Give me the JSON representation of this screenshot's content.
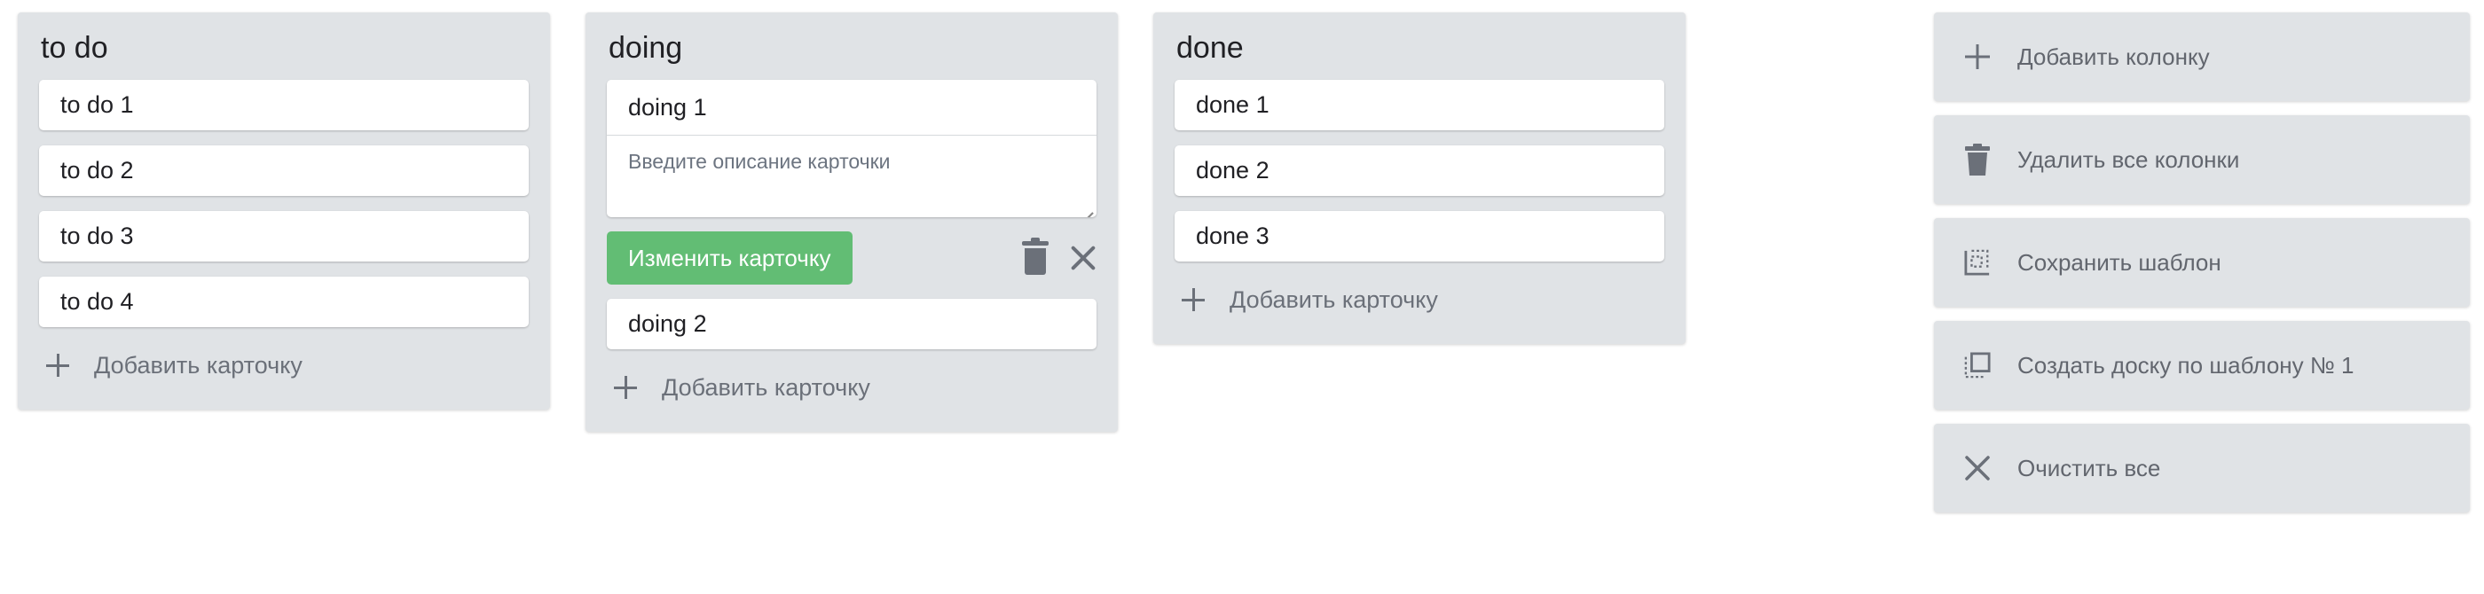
{
  "columns": [
    {
      "title": "to do",
      "cards": [
        "to do 1",
        "to do 2",
        "to do 3",
        "to do 4"
      ],
      "add_label": "Добавить карточку"
    },
    {
      "title": "doing",
      "editing_card": {
        "title": "doing 1",
        "description_placeholder": "Введите описание карточки",
        "save_label": "Изменить карточку"
      },
      "cards": [
        "doing 2"
      ],
      "add_label": "Добавить карточку"
    },
    {
      "title": "done",
      "cards": [
        "done 1",
        "done 2",
        "done 3"
      ],
      "add_label": "Добавить карточку"
    }
  ],
  "side_actions": [
    {
      "label": "Добавить колонку",
      "icon": "plus-icon"
    },
    {
      "label": "Удалить все колонки",
      "icon": "trash-icon"
    },
    {
      "label": "Сохранить шаблон",
      "icon": "save-template-icon"
    },
    {
      "label": "Создать доску по шаблону № 1",
      "icon": "copy-template-icon"
    },
    {
      "label": "Очистить все",
      "icon": "close-icon"
    }
  ],
  "colors": {
    "column_bg": "#e0e3e6",
    "accent_green": "#62bd74",
    "icon_gray": "#6b7079"
  }
}
